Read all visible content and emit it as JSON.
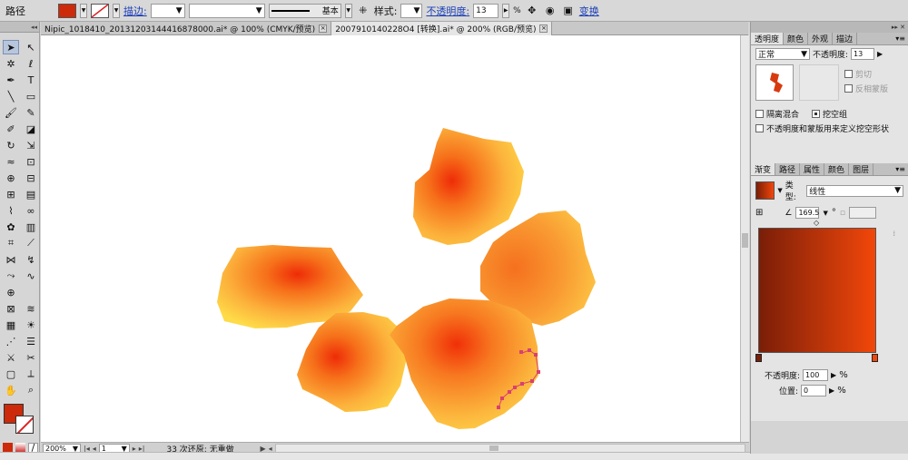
{
  "control_bar": {
    "selection_type": "路径",
    "fill_color": "#cc2a0a",
    "stroke_label": "描边:",
    "stroke_weight": "",
    "brush_name": "基本",
    "style_label": "样式:",
    "opacity_label": "不透明度:",
    "opacity_value": "13",
    "opacity_unit": "%",
    "transform_label": "变换"
  },
  "tabs": [
    {
      "title": "Nipic_1018410_20131203144416878000.ai* @ 100% (CMYK/预览)"
    },
    {
      "title": "2007910140228O4  [转换].ai* @ 200% (RGB/预览)"
    }
  ],
  "tools": {
    "icons": [
      "selection-icon",
      "direct-selection-icon",
      "magic-wand-icon",
      "lasso-icon",
      "pen-icon",
      "type-icon",
      "line-segment-icon",
      "rectangle-icon",
      "paintbrush-icon",
      "pencil-icon",
      "blob-brush-icon",
      "eraser-icon",
      "rotate-icon",
      "scale-icon",
      "warp-icon",
      "free-transform-icon",
      "shape-builder-icon",
      "perspective-grid-icon",
      "mesh-icon",
      "gradient-icon",
      "eyedropper-icon",
      "blend-icon",
      "symbol-sprayer-icon",
      "column-graph-icon",
      "artboard-icon",
      "slice-icon",
      "width-icon",
      "reshape-icon",
      "curve-icon",
      "path-icon",
      "globe-icon",
      "",
      "envelope-icon",
      "wave-icon",
      "grid-icon",
      "flare-icon",
      "zigzag-icon",
      "list-icon",
      "knife-icon",
      "scissors-icon",
      "crop-icon",
      "slice-select-icon",
      "hand-icon",
      "zoom-icon"
    ],
    "fill_color": "#cc2a0a"
  },
  "status_bar": {
    "zoom": "200%",
    "artboard": "1",
    "message": "33 次还原; 无重做"
  },
  "transparency_panel": {
    "tabs": [
      "透明度",
      "颜色",
      "外观",
      "描边"
    ],
    "blend_mode": "正常",
    "opacity_label": "不透明度:",
    "opacity_value": "13",
    "clip_label": "剪切",
    "invert_mask_label": "反相蒙版",
    "isolate_blending_label": "隔离混合",
    "knockout_group_label": "挖空组",
    "opacity_mask_label": "不透明度和蒙版用来定义挖空形状"
  },
  "gradient_panel": {
    "tabs": [
      "渐变",
      "路径",
      "属性",
      "颜色",
      "图层"
    ],
    "type_label": "类型:",
    "type_value": "线性",
    "angle_value": "169.5",
    "angle_unit": "°",
    "stop_opacity_label": "不透明度:",
    "stop_opacity_value": "100",
    "stop_location_label": "位置:",
    "stop_location_value": "0",
    "percent": "%",
    "start_color": "#7a1e08",
    "end_color": "#f2470a"
  }
}
